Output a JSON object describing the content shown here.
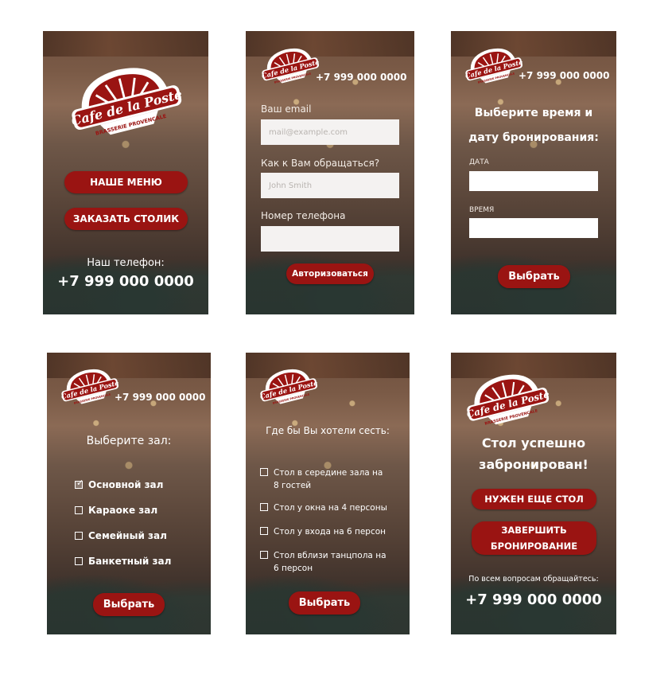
{
  "brand": {
    "logo_text": "Cafe de la Poste",
    "logo_sub": "BRASSERIE PROVENCALE",
    "primary_color": "#9a1412",
    "logo_icon": "cafe-de-la-poste-logo"
  },
  "s1": {
    "menu_btn": "НАШЕ МЕНЮ",
    "book_btn": "ЗАКАЗАТЬ СТОЛИК",
    "phone_label": "Наш телефон:",
    "phone": "+7 999 000 0000"
  },
  "s2": {
    "phone": "+7 999 000 0000",
    "email_label": "Ваш email",
    "email_placeholder": "mail@example.com",
    "name_label": "Как к Вам обращаться?",
    "name_placeholder": "John Smith",
    "phone_field_label": "Номер телефона",
    "phone_field_value": "",
    "submit": "Авторизоваться"
  },
  "s3": {
    "phone": "+7 999 000 0000",
    "title_line1": "Выберите время и",
    "title_line2": "дату бронирования:",
    "date_label": "ДАТА",
    "time_label": "ВРЕМЯ",
    "date_value": "",
    "time_value": "",
    "submit": "Выбрать"
  },
  "s4": {
    "phone": "+7 999 000 0000",
    "title": "Выберите зал:",
    "halls": [
      {
        "label": "Основной зал",
        "checked": true
      },
      {
        "label": "Караоке зал",
        "checked": false
      },
      {
        "label": "Семейный зал",
        "checked": false
      },
      {
        "label": "Банкетный зал",
        "checked": false
      }
    ],
    "submit": "Выбрать"
  },
  "s5": {
    "title": "Где бы Вы хотели сесть:",
    "seats": [
      {
        "line1": "Стол в середине зала на",
        "line2": "8 гостей",
        "checked": false
      },
      {
        "line1": "Стол у окна на 4 персоны",
        "line2": "",
        "checked": false
      },
      {
        "line1": "Стол у входа на 6 персон",
        "line2": "",
        "checked": false
      },
      {
        "line1": "Стол вблизи танцпола на",
        "line2": "6 персон",
        "checked": false
      }
    ],
    "submit": "Выбрать"
  },
  "s6": {
    "title_line1": "Стол успешно",
    "title_line2": "забронирован!",
    "more_btn": "НУЖЕН ЕЩЕ СТОЛ",
    "finish_line1": "ЗАВЕРШИТЬ",
    "finish_line2": "БРОНИРОВАНИЕ",
    "contact_label": "По всем вопросам обращайтесь:",
    "phone": "+7 999 000 0000"
  },
  "check_mark": "✓"
}
